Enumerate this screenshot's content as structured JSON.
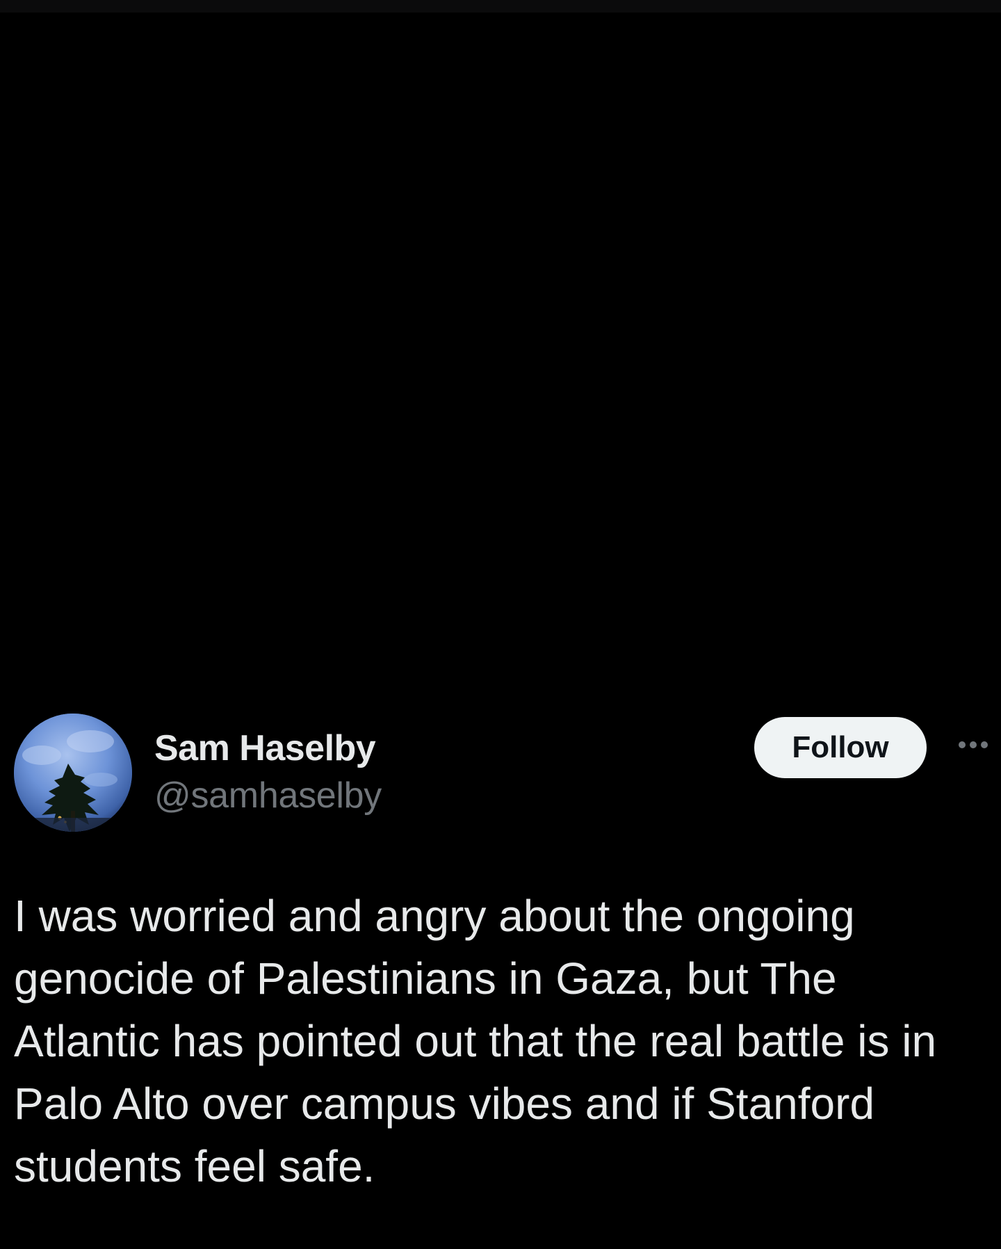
{
  "author": {
    "display_name": "Sam Haselby",
    "handle": "@samhaselby"
  },
  "actions": {
    "follow_label": "Follow"
  },
  "tweet": {
    "text": "I was worried and angry about the ongoing genocide of Palestinians in Gaza, but The Atlantic has pointed out that the real battle is in Palo Alto over campus vibes and if Stanford students feel safe."
  },
  "icons": {
    "avatar": "avatar-tree-sky",
    "more": "more-horizontal-icon"
  },
  "colors": {
    "background": "#000000",
    "primary_text": "#e7e9ea",
    "secondary_text": "#71767b",
    "follow_button_bg": "#eff3f4",
    "follow_button_text": "#0f1419"
  }
}
